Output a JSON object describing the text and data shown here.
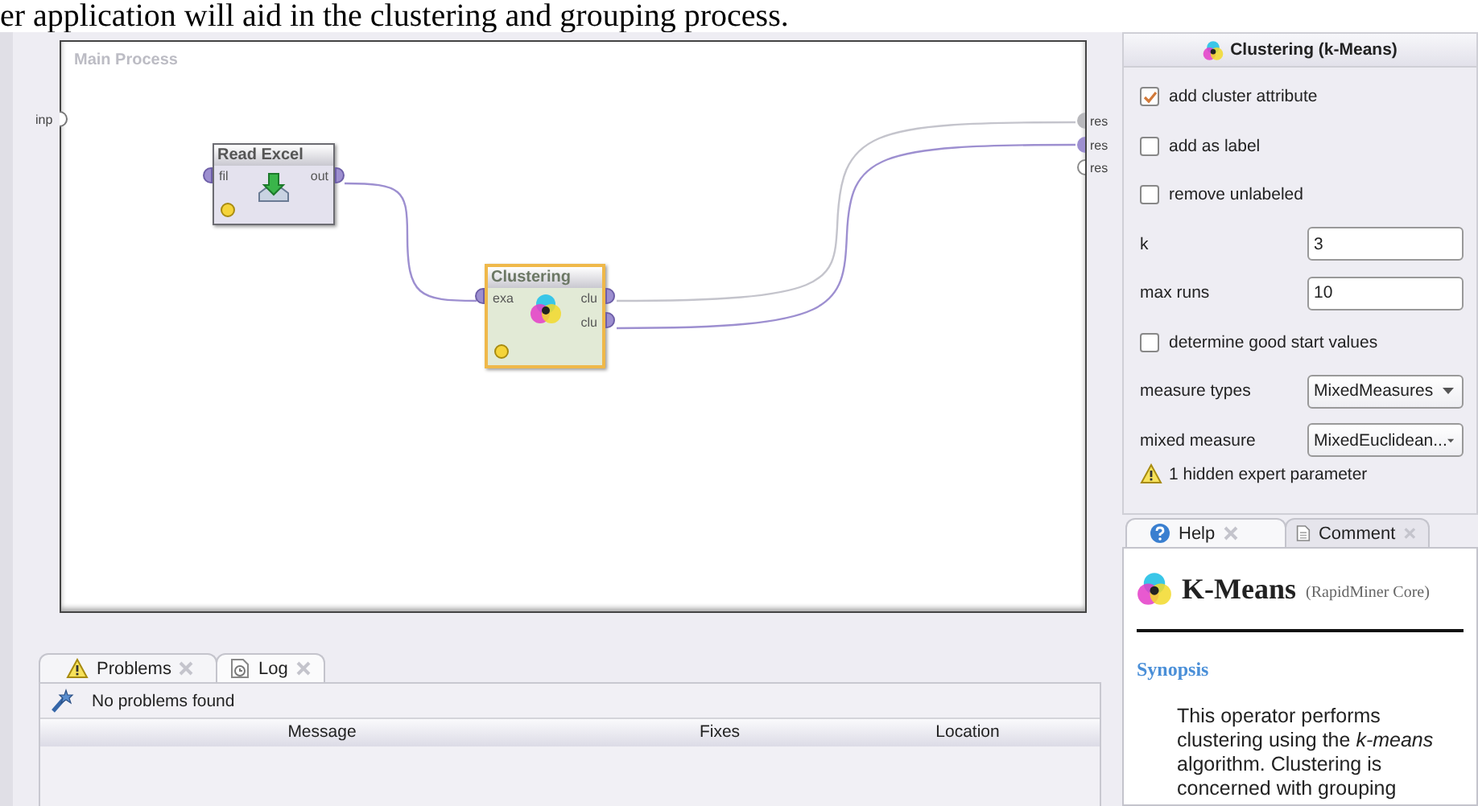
{
  "document_text": "er application will aid in the clustering and grouping process.",
  "process": {
    "title": "Main Process",
    "input_ports": [
      {
        "label": "inp"
      }
    ],
    "operators": [
      {
        "name": "Read Excel",
        "kind": "read",
        "selected": false,
        "inputs": [
          {
            "label": "fil"
          }
        ],
        "outputs": [
          {
            "label": "out"
          }
        ]
      },
      {
        "name": "Clustering",
        "kind": "cluster",
        "selected": true,
        "inputs": [
          {
            "label": "exa"
          }
        ],
        "outputs": [
          {
            "label": "clu"
          },
          {
            "label": "clu"
          }
        ]
      }
    ],
    "result_ports": [
      {
        "label": "res",
        "connected": true,
        "color": "#b8b8bc"
      },
      {
        "label": "res",
        "connected": true,
        "color": "#9d8fd0"
      },
      {
        "label": "res",
        "connected": false,
        "color": "#8a8a8a"
      }
    ]
  },
  "problems": {
    "tabs": [
      {
        "label": "Problems",
        "kind": "problems",
        "selected": true
      },
      {
        "label": "Log",
        "kind": "log",
        "selected": false
      }
    ],
    "status": "No problems found",
    "columns": [
      "Message",
      "Fixes",
      "Location"
    ]
  },
  "parameters": {
    "title": "Clustering (k-Means)",
    "items": [
      {
        "kind": "checkbox",
        "label": "add cluster attribute",
        "checked": true
      },
      {
        "kind": "checkbox",
        "label": "add as label",
        "checked": false
      },
      {
        "kind": "checkbox",
        "label": "remove unlabeled",
        "checked": false
      },
      {
        "kind": "text",
        "label": "k",
        "value": "3"
      },
      {
        "kind": "text",
        "label": "max runs",
        "value": "10"
      },
      {
        "kind": "checkbox",
        "label": "determine good start values",
        "checked": false
      },
      {
        "kind": "dropdown",
        "label": "measure types",
        "value": "MixedMeasures"
      },
      {
        "kind": "dropdown",
        "label": "mixed measure",
        "value": "MixedEuclidean..."
      }
    ],
    "hidden_note": "1 hidden expert parameter"
  },
  "help": {
    "tabs": [
      {
        "label": "Help",
        "kind": "help",
        "selected": true
      },
      {
        "label": "Comment",
        "kind": "comment",
        "selected": false
      }
    ],
    "title": "K-Means",
    "source": "(RapidMiner Core)",
    "section": "Synopsis",
    "text": "This operator performs clustering using the *k-means* algorithm. Clustering is concerned with grouping"
  }
}
